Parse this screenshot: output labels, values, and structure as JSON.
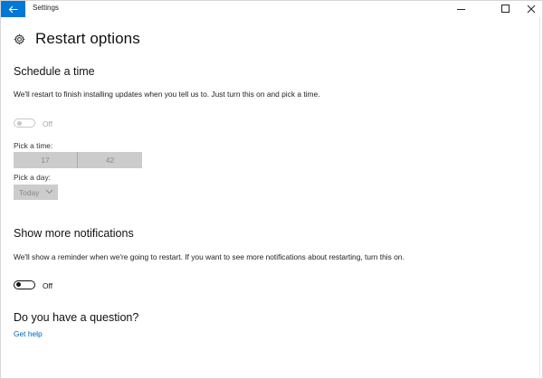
{
  "window": {
    "title": "Settings",
    "accent": "#0078d7"
  },
  "page": {
    "title": "Restart options"
  },
  "schedule": {
    "heading": "Schedule a time",
    "description": "We'll restart to finish installing updates when you tell us to. Just turn this on and pick a time.",
    "toggle_state": "Off",
    "toggle_enabled": false,
    "time_label": "Pick a time:",
    "hour": "17",
    "minute": "42",
    "day_label": "Pick a day:",
    "day_value": "Today"
  },
  "notifications": {
    "heading": "Show more notifications",
    "description": "We'll show a reminder when we're going to restart. If you want to see more notifications about restarting, turn this on.",
    "toggle_state": "Off"
  },
  "question": {
    "heading": "Do you have a question?",
    "link": "Get help",
    "link_color": "#0063b1"
  },
  "icons": {
    "back": "back-arrow-icon",
    "gear": "gear-icon",
    "minimize": "minimize-icon",
    "maximize": "maximize-icon",
    "close": "close-icon",
    "dropdown": "chevron-down-icon"
  }
}
